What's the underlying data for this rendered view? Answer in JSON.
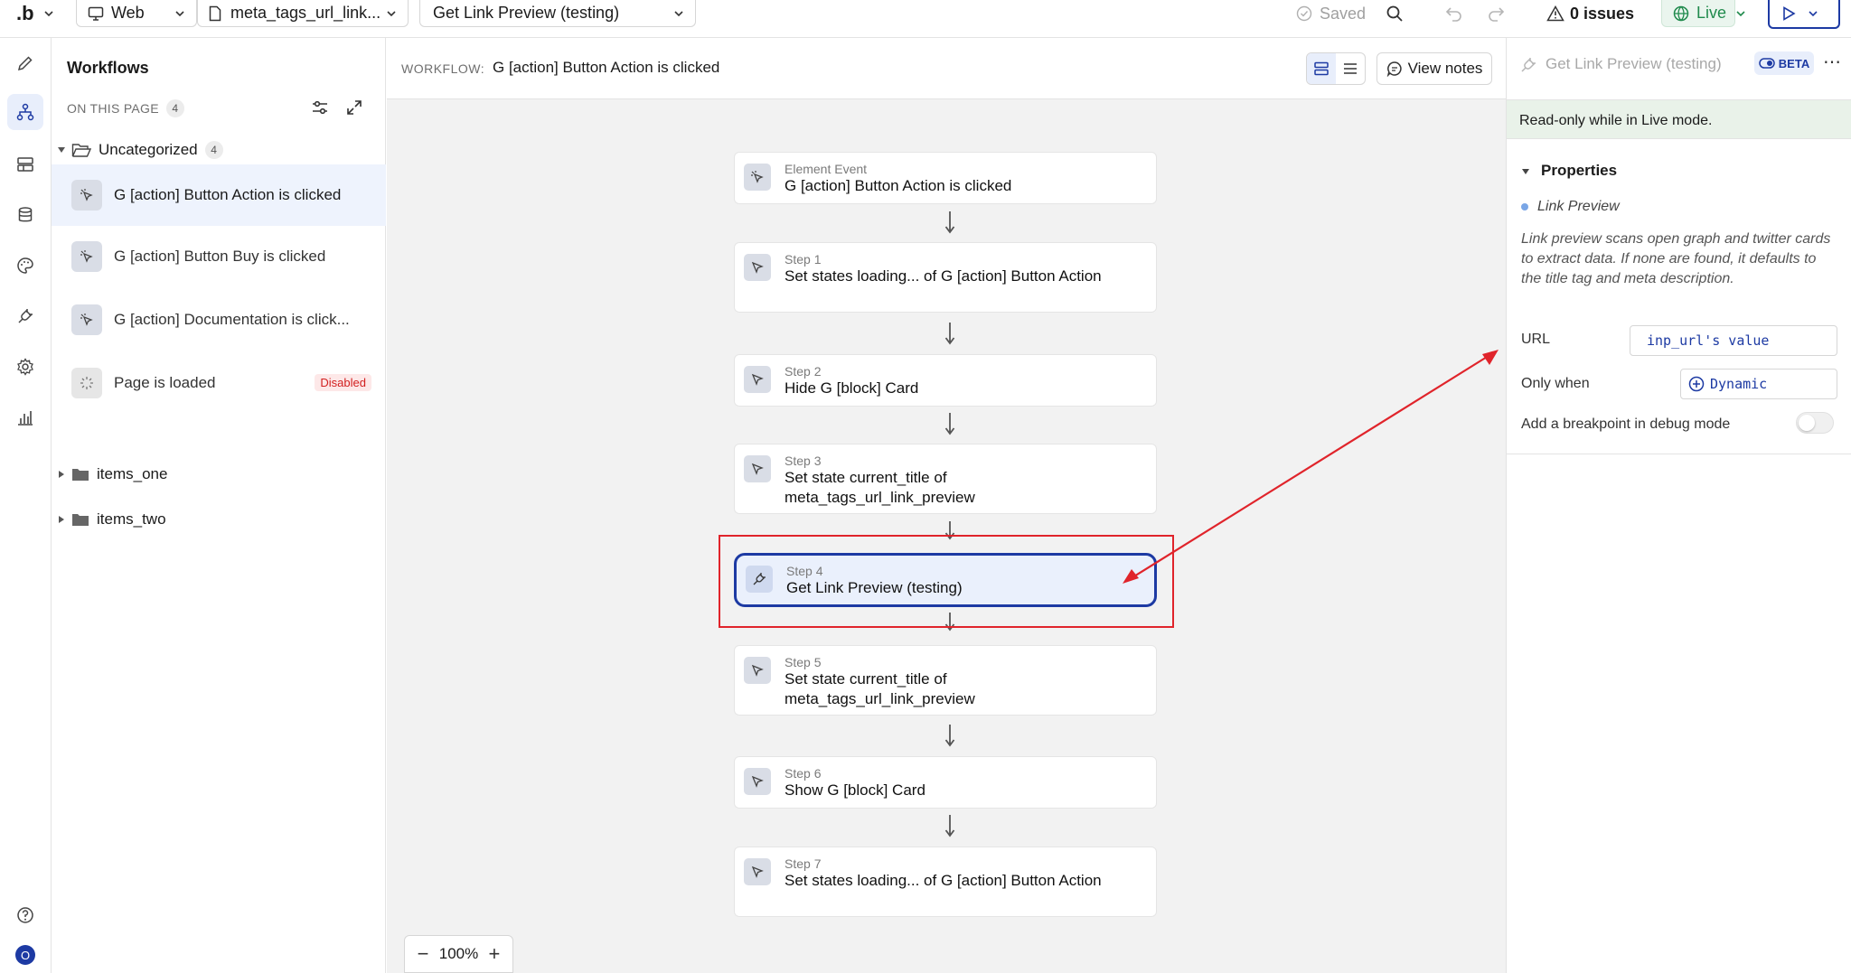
{
  "topbar": {
    "platform": "Web",
    "page": "meta_tags_url_link...",
    "workflow_select": "Get Link Preview (testing)",
    "saved": "Saved",
    "issues": "0 issues",
    "mode": "Live"
  },
  "workflows": {
    "title": "Workflows",
    "on_this_page": "ON THIS PAGE",
    "on_this_page_count": "4",
    "folders": [
      {
        "name": "Uncategorized",
        "count": "4"
      },
      {
        "name": "items_one"
      },
      {
        "name": "items_two"
      }
    ],
    "items": [
      {
        "label": "G [action] Button Action is clicked"
      },
      {
        "label": "G [action] Button Buy is clicked"
      },
      {
        "label": "G [action] Documentation is click..."
      },
      {
        "label": "Page is loaded",
        "badge": "Disabled"
      }
    ]
  },
  "canvas": {
    "workflow_label": "WORKFLOW:",
    "workflow_name": "G [action] Button Action is clicked",
    "view_notes": "View notes",
    "zoom": "100%",
    "steps": [
      {
        "sub": "Element Event",
        "title": "G [action] Button Action is clicked"
      },
      {
        "sub": "Step 1",
        "title": "Set states loading... of G [action] Button Action"
      },
      {
        "sub": "Step 2",
        "title": "Hide G [block] Card"
      },
      {
        "sub": "Step 3",
        "title": "Set state current_title of meta_tags_url_link_preview"
      },
      {
        "sub": "Step 4",
        "title": "Get Link Preview (testing)"
      },
      {
        "sub": "Step 5",
        "title": "Set state current_title of meta_tags_url_link_preview"
      },
      {
        "sub": "Step 6",
        "title": "Show G [block] Card"
      },
      {
        "sub": "Step 7",
        "title": "Set states loading... of G [action] Button Action"
      }
    ]
  },
  "properties": {
    "name": "Get Link Preview (testing)",
    "beta": "BETA",
    "readonly_notice": "Read-only while in Live mode.",
    "section_title": "Properties",
    "plugin_name": "Link Preview",
    "description": "Link preview scans open graph and twitter cards to extract data. If none are found, it defaults to the title tag and meta description.",
    "url_label": "URL",
    "url_value": "inp_url's value",
    "only_when_label": "Only when",
    "only_when_value": "Dynamic",
    "breakpoint_label": "Add a breakpoint in debug mode"
  },
  "colors": {
    "accent": "#1d3aa3",
    "annotation": "#e0242b",
    "live": "#1f8a4c"
  }
}
